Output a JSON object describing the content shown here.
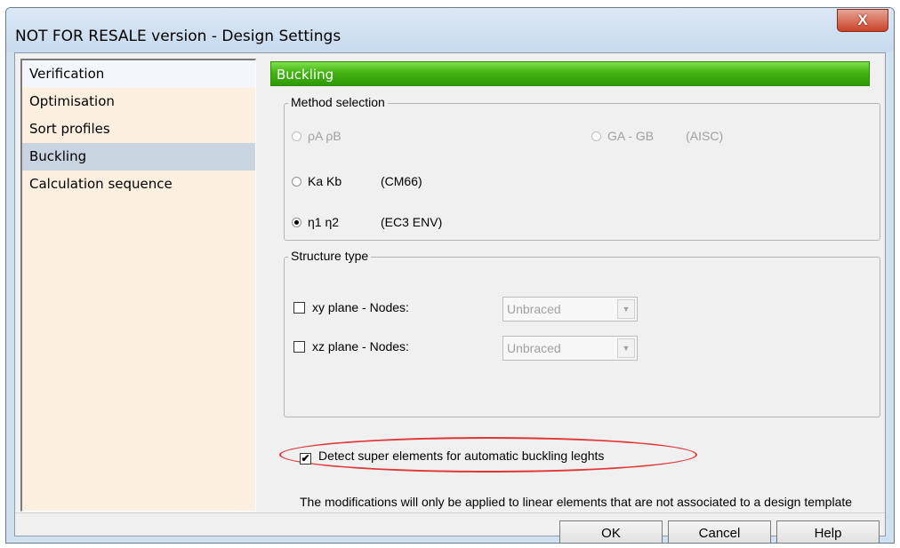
{
  "window": {
    "title": "NOT FOR RESALE version - Design Settings",
    "close_glyph": "X"
  },
  "sidebar": {
    "items": [
      {
        "label": "Verification"
      },
      {
        "label": "Optimisation"
      },
      {
        "label": "Sort profiles"
      },
      {
        "label": "Buckling"
      },
      {
        "label": "Calculation sequence"
      }
    ],
    "selected": "Buckling"
  },
  "main": {
    "header": "Buckling",
    "method_selection": {
      "legend": "Method selection",
      "options": [
        {
          "label": "ρA ρB",
          "note": "",
          "checked": false,
          "enabled": false
        },
        {
          "label": "GA - GB",
          "note": "(AISC)",
          "checked": false,
          "enabled": false
        },
        {
          "label": "Ka Kb",
          "note": "(CM66)",
          "checked": false,
          "enabled": true
        },
        {
          "label": "η1 η2",
          "note": "(EC3 ENV)",
          "checked": true,
          "enabled": true
        }
      ]
    },
    "structure_type": {
      "legend": "Structure type",
      "rows": [
        {
          "label": "xy plane - Nodes:",
          "checked": false,
          "value": "Unbraced"
        },
        {
          "label": "xz plane - Nodes:",
          "checked": false,
          "value": "Unbraced"
        }
      ]
    },
    "detect_super_elements": {
      "label": "Detect super elements for automatic buckling leghts",
      "checked": true,
      "check_glyph": "✔"
    },
    "note": "The modifications will only be applied to linear elements that are not associated to a design template"
  },
  "buttons": {
    "ok": "OK",
    "cancel": "Cancel",
    "help": "Help"
  }
}
